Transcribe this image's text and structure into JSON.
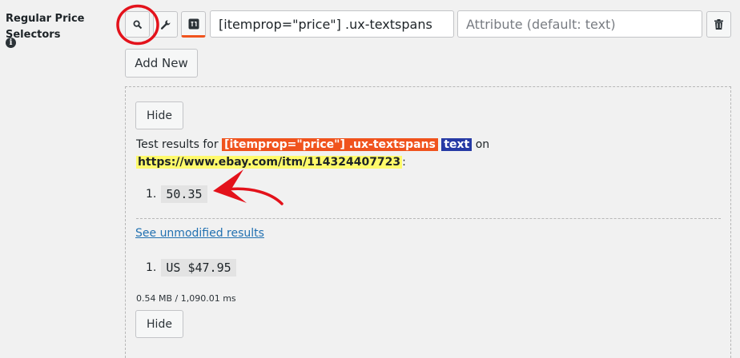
{
  "field": {
    "label": "Regular Price Selectors",
    "info_icon": "i"
  },
  "toolbar": {
    "search_icon": "search",
    "wrench_icon": "wrench",
    "extract_icon": "extract"
  },
  "selector_input": {
    "value": "[itemprop=\"price\"] .ux-textspans"
  },
  "attribute_input": {
    "placeholder": "Attribute (default: text)"
  },
  "add_new_label": "Add New",
  "results": {
    "hide_label": "Hide",
    "prefix": "Test results for",
    "selector": "[itemprop=\"price\"] .ux-textspans",
    "attribute": "text",
    "on_word": "on",
    "url": "https://www.ebay.com/itm/114324407723",
    "suffix": ":",
    "items": [
      {
        "index": "1.",
        "value": "50.35"
      }
    ],
    "unmodified_link": "See unmodified results",
    "unmodified_items": [
      {
        "index": "1.",
        "value": "US $47.95"
      }
    ],
    "stats": "0.54 MB / 1,090.01 ms",
    "hide_label_bottom": "Hide"
  },
  "colors": {
    "accent_orange": "#f0531d",
    "accent_navy": "#263aa5",
    "highlight_yellow": "#fffa6b",
    "annotation_red": "#e3121b",
    "link_blue": "#2271b1"
  }
}
